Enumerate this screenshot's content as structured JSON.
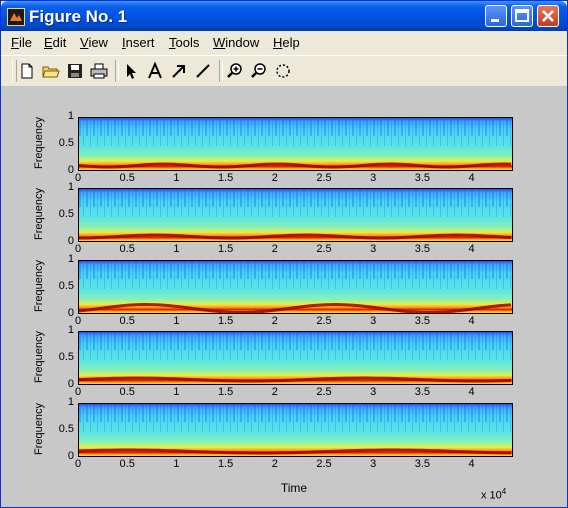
{
  "window": {
    "title": "Figure No. 1",
    "colors": {
      "titlebar": "#0054e3",
      "close": "#c23b1d",
      "figure_bg": "#c8c8c8"
    }
  },
  "titlebar_buttons": [
    "minimize-icon",
    "maximize-icon",
    "close-icon"
  ],
  "menu": [
    {
      "label": "File",
      "key": "F"
    },
    {
      "label": "Edit",
      "key": "E"
    },
    {
      "label": "View",
      "key": "V"
    },
    {
      "label": "Insert",
      "key": "I"
    },
    {
      "label": "Tools",
      "key": "T"
    },
    {
      "label": "Window",
      "key": "W"
    },
    {
      "label": "Help",
      "key": "H"
    }
  ],
  "toolbar": [
    "new-file-icon",
    "open-folder-icon",
    "save-icon",
    "print-icon",
    "select-arrow-icon",
    "insert-text-icon",
    "insert-arrow-icon",
    "insert-line-icon",
    "zoom-in-icon",
    "zoom-out-icon",
    "rotate-icon"
  ],
  "plots": {
    "ylabel": "Frequency",
    "xlabel": "Time",
    "x_exponent_base": "x 10",
    "x_exponent_power": "4",
    "yticks": [
      "0",
      "0.5",
      "1"
    ],
    "xticks": [
      "0",
      "0.5",
      "1",
      "1.5",
      "2",
      "2.5",
      "3",
      "3.5",
      "4"
    ],
    "count": 5
  }
}
